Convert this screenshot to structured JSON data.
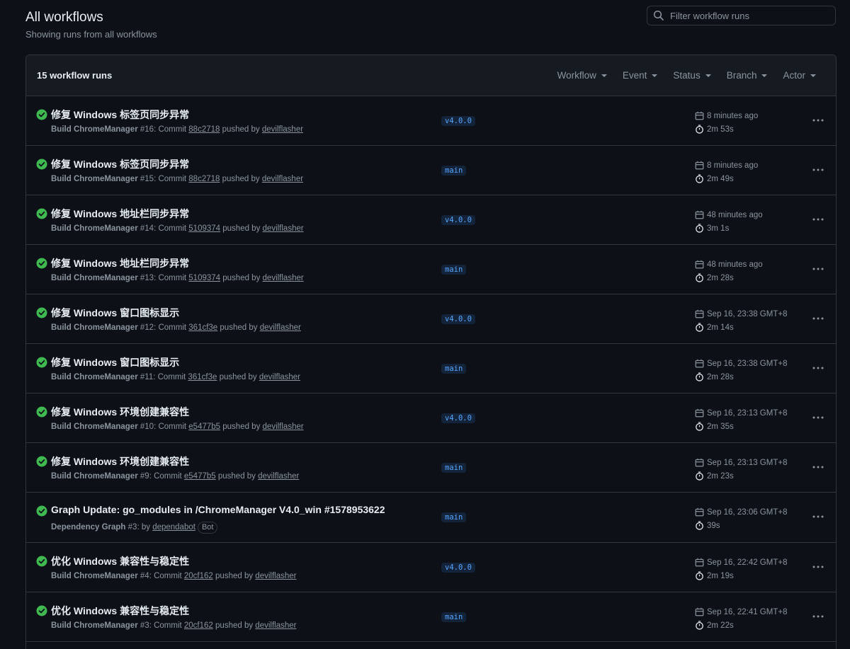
{
  "header": {
    "title": "All workflows",
    "subtitle": "Showing runs from all workflows"
  },
  "search": {
    "placeholder": "Filter workflow runs"
  },
  "list": {
    "count_label": "15 workflow runs",
    "filters": [
      "Workflow",
      "Event",
      "Status",
      "Branch",
      "Actor"
    ]
  },
  "colors": {
    "success": "#3fb950",
    "branch": "#58a6ff",
    "muted": "#8b949e"
  },
  "runs": [
    {
      "title": "修复 Windows 标签页同步异常",
      "workflow": "Build ChromeManager",
      "number": "#16",
      "sep": ": Commit ",
      "commit": "88c2718",
      "pushed": " pushed by ",
      "actor": "devilflasher",
      "branch": "v4.0.0",
      "time": "8 minutes ago",
      "duration": "2m 53s",
      "status": "success"
    },
    {
      "title": "修复 Windows 标签页同步异常",
      "workflow": "Build ChromeManager",
      "number": "#15",
      "sep": ": Commit ",
      "commit": "88c2718",
      "pushed": " pushed by ",
      "actor": "devilflasher",
      "branch": "main",
      "time": "8 minutes ago",
      "duration": "2m 49s",
      "status": "success"
    },
    {
      "title": "修复 Windows 地址栏同步异常",
      "workflow": "Build ChromeManager",
      "number": "#14",
      "sep": ": Commit ",
      "commit": "5109374",
      "pushed": " pushed by ",
      "actor": "devilflasher",
      "branch": "v4.0.0",
      "time": "48 minutes ago",
      "duration": "3m 1s",
      "status": "success"
    },
    {
      "title": "修复 Windows 地址栏同步异常",
      "workflow": "Build ChromeManager",
      "number": "#13",
      "sep": ": Commit ",
      "commit": "5109374",
      "pushed": " pushed by ",
      "actor": "devilflasher",
      "branch": "main",
      "time": "48 minutes ago",
      "duration": "2m 28s",
      "status": "success"
    },
    {
      "title": "修复 Windows 窗口图标显示",
      "workflow": "Build ChromeManager",
      "number": "#12",
      "sep": ": Commit ",
      "commit": "361cf3e",
      "pushed": " pushed by ",
      "actor": "devilflasher",
      "branch": "v4.0.0",
      "time": "Sep 16, 23:38 GMT+8",
      "duration": "2m 14s",
      "status": "success"
    },
    {
      "title": "修复 Windows 窗口图标显示",
      "workflow": "Build ChromeManager",
      "number": "#11",
      "sep": ": Commit ",
      "commit": "361cf3e",
      "pushed": " pushed by ",
      "actor": "devilflasher",
      "branch": "main",
      "time": "Sep 16, 23:38 GMT+8",
      "duration": "2m 28s",
      "status": "success"
    },
    {
      "title": "修复 Windows 环境创建兼容性",
      "workflow": "Build ChromeManager",
      "number": "#10",
      "sep": ": Commit ",
      "commit": "e5477b5",
      "pushed": " pushed by ",
      "actor": "devilflasher",
      "branch": "v4.0.0",
      "time": "Sep 16, 23:13 GMT+8",
      "duration": "2m 35s",
      "status": "success"
    },
    {
      "title": "修复 Windows 环境创建兼容性",
      "workflow": "Build ChromeManager",
      "number": "#9",
      "sep": ": Commit ",
      "commit": "e5477b5",
      "pushed": " pushed by ",
      "actor": "devilflasher",
      "branch": "main",
      "time": "Sep 16, 23:13 GMT+8",
      "duration": "2m 23s",
      "status": "success"
    },
    {
      "title": "Graph Update: go_modules in /ChromeManager V4.0_win #1578953622",
      "workflow": "Dependency Graph",
      "number": "#3",
      "sep": ": by ",
      "commit": "",
      "pushed": "",
      "actor": "dependabot",
      "badge": "Bot",
      "branch": "main",
      "time": "Sep 16, 23:06 GMT+8",
      "duration": "39s",
      "status": "success"
    },
    {
      "title": "优化 Windows 兼容性与稳定性",
      "workflow": "Build ChromeManager",
      "number": "#4",
      "sep": ": Commit ",
      "commit": "20cf162",
      "pushed": " pushed by ",
      "actor": "devilflasher",
      "branch": "v4.0.0",
      "time": "Sep 16, 22:42 GMT+8",
      "duration": "2m 19s",
      "status": "success"
    },
    {
      "title": "优化 Windows 兼容性与稳定性",
      "workflow": "Build ChromeManager",
      "number": "#3",
      "sep": ": Commit ",
      "commit": "20cf162",
      "pushed": " pushed by ",
      "actor": "devilflasher",
      "branch": "main",
      "time": "Sep 16, 22:41 GMT+8",
      "duration": "2m 22s",
      "status": "success"
    }
  ]
}
